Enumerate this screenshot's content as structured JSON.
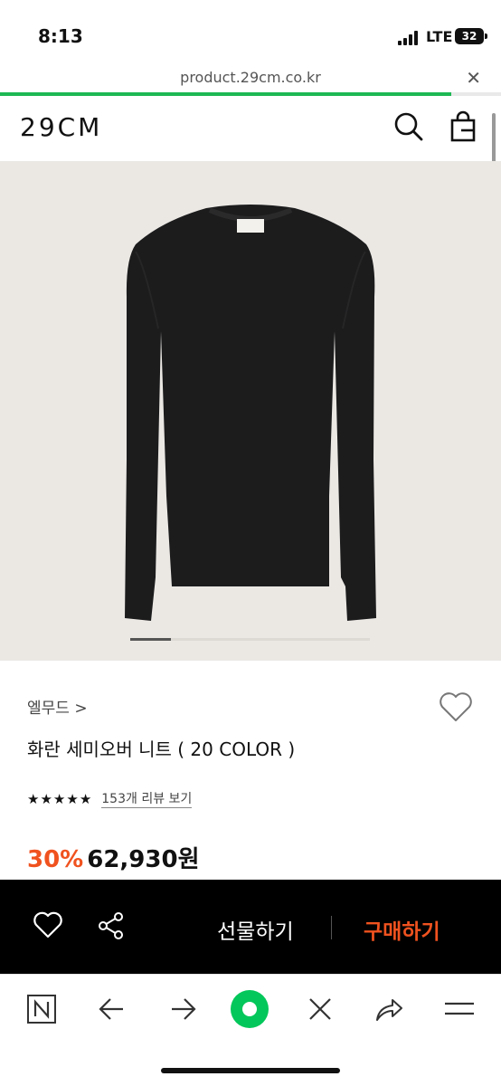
{
  "status": {
    "time": "8:13",
    "network": "LTE",
    "battery": "32"
  },
  "browser": {
    "url": "product.29cm.co.kr",
    "load_progress": 0.9
  },
  "header": {
    "logo": "29CM"
  },
  "carousel": {
    "active_index": 0,
    "indicator_fraction": 0.17
  },
  "product": {
    "brand": "엘무드 >",
    "title": "화란 세미오버 니트 ( 20 COLOR )",
    "stars": 5,
    "review_link": "153개 리뷰 보기",
    "discount": "30%",
    "price": "62,930원"
  },
  "actions": {
    "gift": "선물하기",
    "buy": "구매하기"
  },
  "colors": {
    "accent": "#f0521f",
    "progress": "#1db854",
    "action_bar": "#000000",
    "naver_green": "#03c75a"
  }
}
